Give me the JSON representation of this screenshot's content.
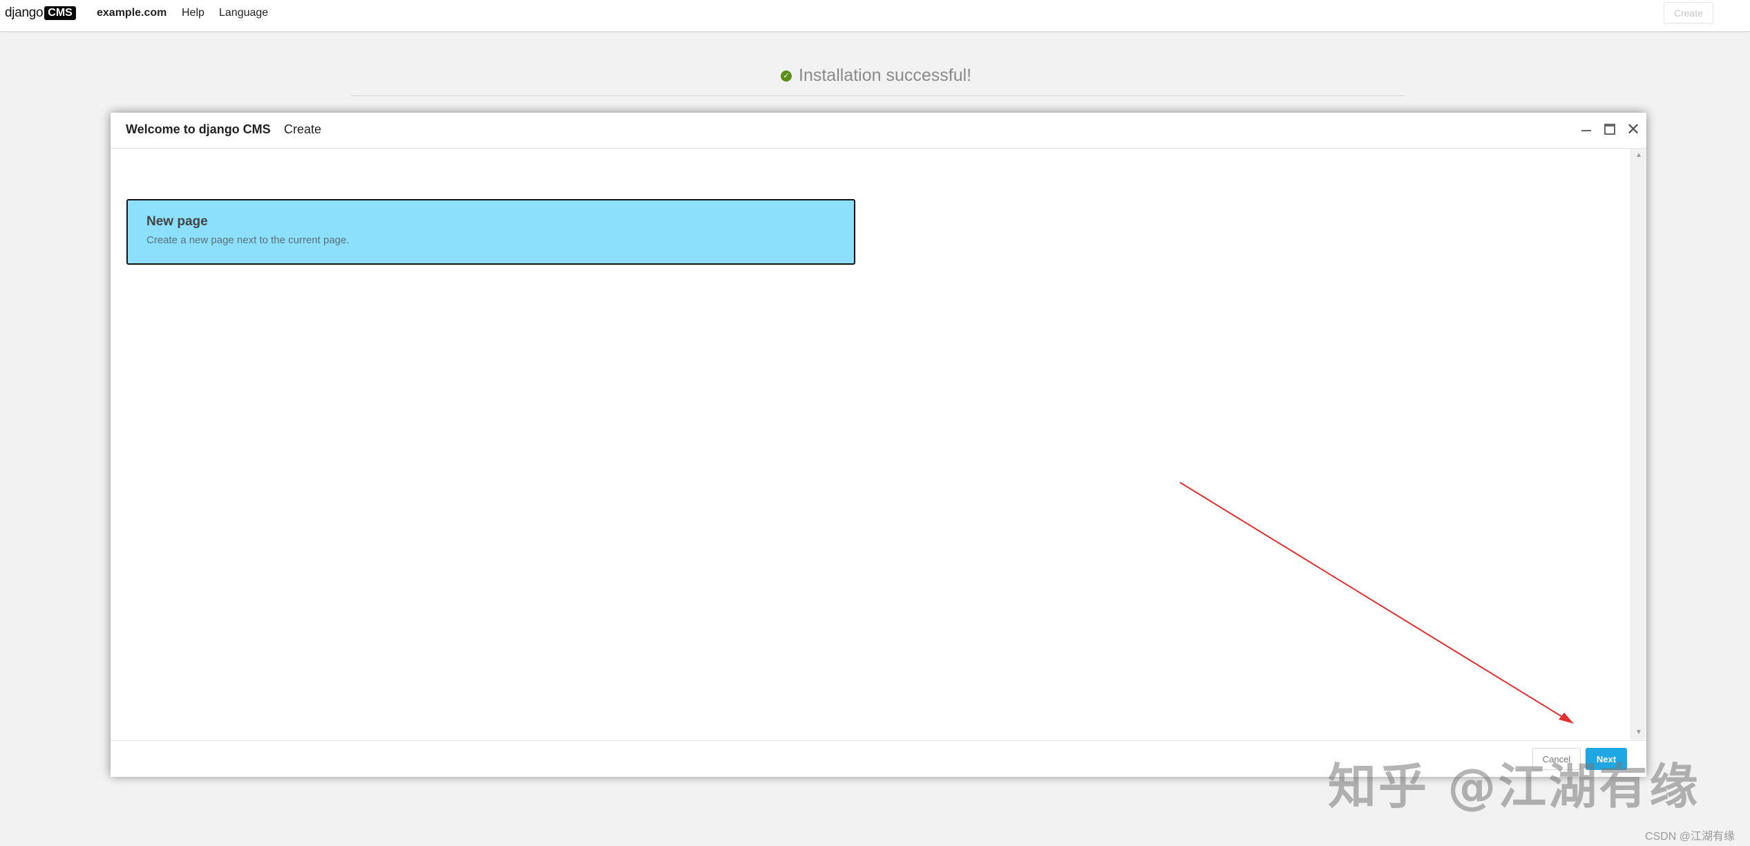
{
  "toolbar": {
    "logo_text": "django",
    "logo_badge": "CMS",
    "site": "example.com",
    "help": "Help",
    "language": "Language",
    "create_button": "Create"
  },
  "page": {
    "install_message": "Installation successful!"
  },
  "modal": {
    "title": "Welcome to django CMS",
    "breadcrumb": "Create",
    "choices": [
      {
        "title": "New page",
        "description": "Create a new page next to the current page."
      }
    ],
    "footer": {
      "cancel_label": "Cancel",
      "next_label": "Next"
    }
  },
  "watermark": {
    "zhihu": "知乎 @江湖有缘",
    "csdn": "CSDN @江湖有缘"
  },
  "colors": {
    "choice_bg": "#8ce0fc",
    "primary_button": "#1ea7e2",
    "annotation_arrow": "#e03030",
    "success_check": "#5a8f1a"
  }
}
